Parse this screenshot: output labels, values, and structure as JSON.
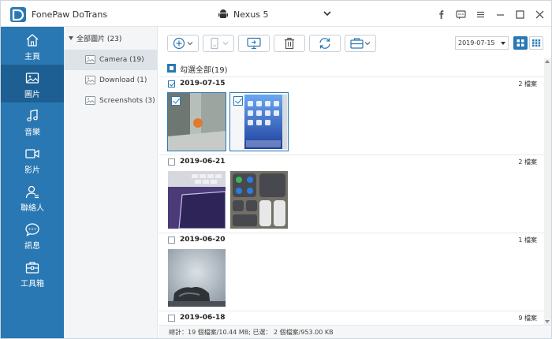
{
  "app": {
    "title": "FonePaw DoTrans"
  },
  "device": {
    "name": "Nexus 5"
  },
  "nav": {
    "items": [
      {
        "label": "主頁",
        "icon": "home-icon"
      },
      {
        "label": "圖片",
        "icon": "image-icon"
      },
      {
        "label": "音樂",
        "icon": "music-icon"
      },
      {
        "label": "影片",
        "icon": "video-icon"
      },
      {
        "label": "聯絡人",
        "icon": "contacts-icon"
      },
      {
        "label": "訊息",
        "icon": "message-icon"
      },
      {
        "label": "工具箱",
        "icon": "toolbox-icon"
      }
    ],
    "active_index": 1
  },
  "categories": {
    "root": "全部圖片 (23)",
    "items": [
      {
        "label": "Camera (19)"
      },
      {
        "label": "Download (1)"
      },
      {
        "label": "Screenshots (3)"
      }
    ]
  },
  "toolbar": {
    "date": "2019-07-15"
  },
  "content": {
    "select_all": "勾選全部(19)",
    "groups": [
      {
        "date": "2019-07-15",
        "count": "2 檔案",
        "checked": true
      },
      {
        "date": "2019-06-21",
        "count": "2 檔案",
        "checked": false
      },
      {
        "date": "2019-06-20",
        "count": "1 檔案",
        "checked": false
      },
      {
        "date": "2019-06-18",
        "count": "9 檔案",
        "checked": false
      }
    ]
  },
  "status": {
    "text": "總計：19 個檔案/10.44 MB; 已選： 2 個檔案/953.00 KB"
  },
  "colors": {
    "nav_bg": "#2a78b3",
    "nav_active": "#1d5f92",
    "accent": "#2a78b3"
  }
}
